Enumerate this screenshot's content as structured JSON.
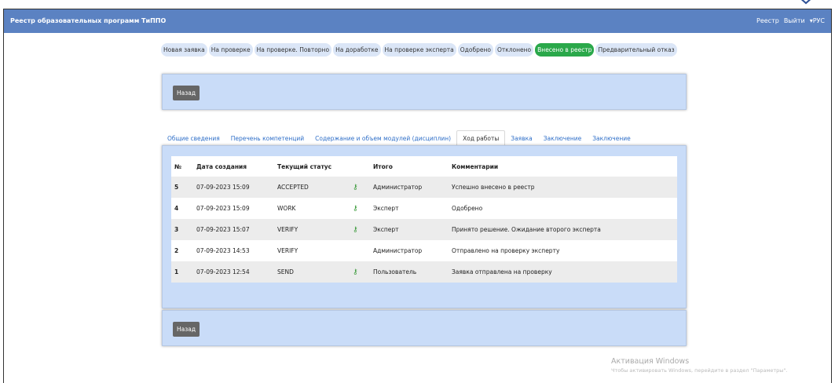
{
  "navbar": {
    "title": "Реестр образовательных программ ТиППО",
    "links": [
      "Реестр",
      "Выйти",
      "▾РУС"
    ]
  },
  "statuses": [
    {
      "label": "Новая заявка",
      "active": false
    },
    {
      "label": "На проверке",
      "active": false
    },
    {
      "label": "На проверке. Повторно",
      "active": false
    },
    {
      "label": "На доработке",
      "active": false
    },
    {
      "label": "На проверке эксперта",
      "active": false
    },
    {
      "label": "Одобрено",
      "active": false
    },
    {
      "label": "Отклонено",
      "active": false
    },
    {
      "label": "Внесено в реестр",
      "active": true
    },
    {
      "label": "Предварительный отказ",
      "active": false
    }
  ],
  "back_label": "Назад",
  "tabs": [
    {
      "label": "Общие сведения",
      "active": false
    },
    {
      "label": "Перечень компетенций",
      "active": false
    },
    {
      "label": "Содержание и объем модулей (дисциплин)",
      "active": false
    },
    {
      "label": "Ход работы",
      "active": true
    },
    {
      "label": "Заявка",
      "active": false
    },
    {
      "label": "Заключение",
      "active": false
    },
    {
      "label": "Заключение",
      "active": false
    }
  ],
  "table": {
    "headers": [
      "№",
      "Дата создания",
      "Текущий статус",
      "",
      "Итого",
      "Комментарии"
    ],
    "rows": [
      {
        "num": "5",
        "date": "07-09-2023 15:09",
        "status": "ACCEPTED",
        "key": true,
        "role": "Администратор",
        "comment": "Успешно внесено в реестр"
      },
      {
        "num": "4",
        "date": "07-09-2023 15:09",
        "status": "WORK",
        "key": true,
        "role": "Эксперт",
        "comment": "Одобрено"
      },
      {
        "num": "3",
        "date": "07-09-2023 15:07",
        "status": "VERIFY",
        "key": true,
        "role": "Эксперт",
        "comment": "Принято решение. Ожидание второго эксперта"
      },
      {
        "num": "2",
        "date": "07-09-2023 14:53",
        "status": "VERIFY",
        "key": false,
        "role": "Администратор",
        "comment": "Отправлено на проверку эксперту"
      },
      {
        "num": "1",
        "date": "07-09-2023 12:54",
        "status": "SEND",
        "key": true,
        "role": "Пользователь",
        "comment": "Заявка отправлена на проверку"
      }
    ]
  },
  "watermark": {
    "title": "Активация Windows",
    "subtitle": "Чтобы активировать Windows, перейдите в раздел \"Параметры\"."
  },
  "colors": {
    "navbar": "#5b82c2",
    "active_status": "#2aa84a",
    "panel": "#c9dcf8"
  }
}
